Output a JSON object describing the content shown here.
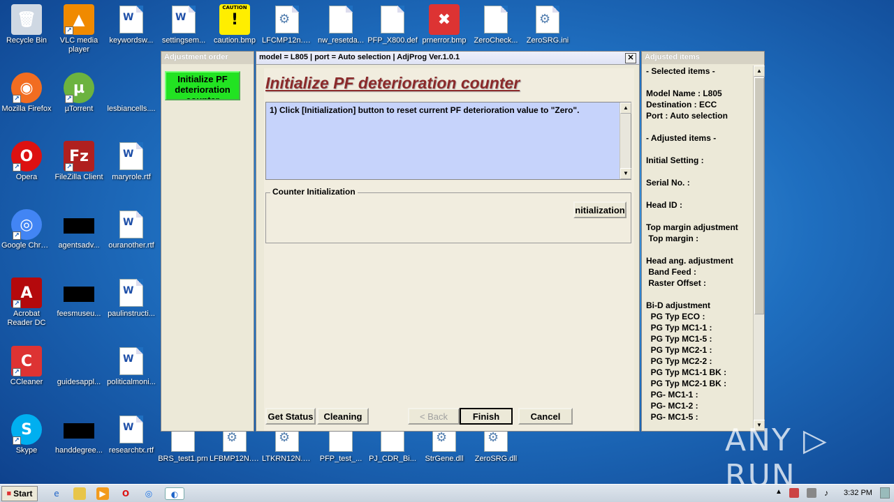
{
  "desktop_icons": [
    {
      "label": "Recycle Bin",
      "glyph": "🗑"
    },
    {
      "label": "VLC media player",
      "glyph": "▲"
    },
    {
      "label": "keywordsw...",
      "glyph": "W"
    },
    {
      "label": "settingsem...",
      "glyph": "W"
    },
    {
      "label": "caution.bmp",
      "glyph": "!",
      "badge": "CAUTION"
    },
    {
      "label": "LFCMP12n.DLL",
      "glyph": "⚙"
    },
    {
      "label": "nw_resetda...",
      "glyph": ""
    },
    {
      "label": "PFP_X800.def",
      "glyph": ""
    },
    {
      "label": "prnerror.bmp",
      "glyph": "✖"
    },
    {
      "label": "ZeroCheck...",
      "glyph": ""
    },
    {
      "label": "ZeroSRG.ini",
      "glyph": "⚙"
    },
    {
      "label": "Mozilla Firefox",
      "glyph": "◉"
    },
    {
      "label": "µTorrent",
      "glyph": "µ"
    },
    {
      "label": "lesbiancells....",
      "glyph": ""
    },
    {
      "label": "Opera",
      "glyph": "O"
    },
    {
      "label": "FileZilla Client",
      "glyph": "Fz"
    },
    {
      "label": "maryrole.rtf",
      "glyph": "W"
    },
    {
      "label": "Google Chrome",
      "glyph": "◎"
    },
    {
      "label": "agentsadv...",
      "glyph": ""
    },
    {
      "label": "ouranother.rtf",
      "glyph": "W"
    },
    {
      "label": "Acrobat Reader DC",
      "glyph": "A"
    },
    {
      "label": "feesmuseu...",
      "glyph": ""
    },
    {
      "label": "paulinstructi...",
      "glyph": "W"
    },
    {
      "label": "CCleaner",
      "glyph": "C"
    },
    {
      "label": "guidesappl...",
      "glyph": ""
    },
    {
      "label": "politicalmoni...",
      "glyph": "W"
    },
    {
      "label": "Skype",
      "glyph": "S"
    },
    {
      "label": "handdegree...",
      "glyph": ""
    },
    {
      "label": "researchtx.rtf",
      "glyph": "W"
    },
    {
      "label": "BRS_test1.prn",
      "glyph": ""
    },
    {
      "label": "LFBMP12N.DLL",
      "glyph": "⚙"
    },
    {
      "label": "LTKRN12N.DLL",
      "glyph": "⚙"
    },
    {
      "label": "PFP_test_...",
      "glyph": ""
    },
    {
      "label": "PJ_CDR_Bi...",
      "glyph": ""
    },
    {
      "label": "StrGene.dll",
      "glyph": "⚙"
    },
    {
      "label": "ZeroSRG.dll",
      "glyph": "⚙"
    }
  ],
  "adjustment_order": {
    "title": "Adjustment order",
    "active_item": "Initialize PF deterioration counter"
  },
  "main_window": {
    "title": "model = L805 | port = Auto selection | AdjProg Ver.1.0.1",
    "close_glyph": "✕",
    "heading": "Initialize PF deterioration counter",
    "instruction": "1) Click [Initialization] button to reset current PF deterioration value to \"Zero\".",
    "group_label": "Counter Initialization",
    "init_button": "nitialization",
    "buttons": {
      "get_status": "Get Status",
      "cleaning": "Cleaning",
      "back": "< Back",
      "finish": "Finish",
      "cancel": "Cancel"
    }
  },
  "adjusted_items": {
    "title": "Adjusted items",
    "lines": [
      "- Selected items -",
      "",
      "Model Name : L805",
      "Destination : ECC",
      "Port : Auto selection",
      "",
      "- Adjusted items -",
      "",
      "Initial Setting :",
      "",
      "Serial No. :",
      "",
      "Head ID :",
      "",
      "Top margin adjustment",
      " Top margin :",
      "",
      "Head ang. adjustment",
      " Band Feed :",
      " Raster Offset :",
      "",
      "Bi-D adjustment",
      "  PG Typ ECO :",
      "  PG Typ MC1-1 :",
      "  PG Typ MC1-5 :",
      "  PG Typ MC2-1 :",
      "  PG Typ MC2-2 :",
      "  PG Typ MC1-1 BK :",
      "  PG Typ MC2-1 BK :",
      "  PG- MC1-1 :",
      "  PG- MC1-2 :",
      "  PG- MC1-5 :"
    ]
  },
  "taskbar": {
    "start_label": "Start",
    "clock": "3:32 PM",
    "tray_arrow": "▲"
  },
  "watermark": "ANY ▷ RUN",
  "colors": {
    "instruction_bg": "#c6d3fb",
    "active_item_bg": "#22e322",
    "heading_color": "#8b2a2a"
  }
}
